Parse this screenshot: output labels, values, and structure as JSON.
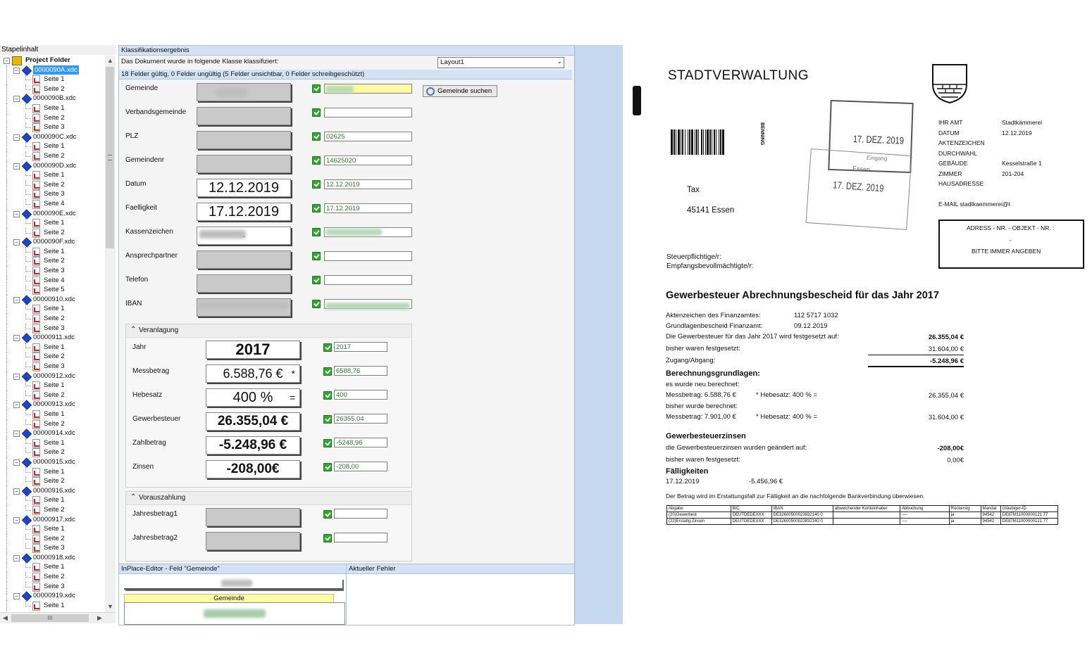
{
  "tree": {
    "title": "Stapelinhalt",
    "root_label": "Project Folder",
    "items": [
      {
        "doc": "0000090A.xdc",
        "pages": [
          "Seite 1",
          "Seite 2"
        ],
        "selected": true
      },
      {
        "doc": "0000090B.xdc",
        "pages": [
          "Seite 1",
          "Seite 2",
          "Seite 3"
        ]
      },
      {
        "doc": "0000090C.xdc",
        "pages": [
          "Seite 1",
          "Seite 2"
        ]
      },
      {
        "doc": "0000090D.xdc",
        "pages": [
          "Seite 1",
          "Seite 2",
          "Seite 3",
          "Seite 4"
        ]
      },
      {
        "doc": "0000090E.xdc",
        "pages": [
          "Seite 1",
          "Seite 2"
        ]
      },
      {
        "doc": "0000090F.xdc",
        "pages": [
          "Seite 1",
          "Seite 2",
          "Seite 3",
          "Seite 4",
          "Seite 5"
        ]
      },
      {
        "doc": "00000910.xdc",
        "pages": [
          "Seite 1",
          "Seite 2",
          "Seite 3"
        ]
      },
      {
        "doc": "00000911.xdc",
        "pages": [
          "Seite 1",
          "Seite 2",
          "Seite 3"
        ]
      },
      {
        "doc": "00000912.xdc",
        "pages": [
          "Seite 1",
          "Seite 2"
        ]
      },
      {
        "doc": "00000913.xdc",
        "pages": [
          "Seite 1",
          "Seite 2"
        ]
      },
      {
        "doc": "00000914.xdc",
        "pages": [
          "Seite 1",
          "Seite 2"
        ]
      },
      {
        "doc": "00000915.xdc",
        "pages": [
          "Seite 1",
          "Seite 2"
        ]
      },
      {
        "doc": "00000916.xdc",
        "pages": [
          "Seite 1",
          "Seite 2"
        ]
      },
      {
        "doc": "00000917.xdc",
        "pages": [
          "Seite 1",
          "Seite 2",
          "Seite 3"
        ]
      },
      {
        "doc": "00000918.xdc",
        "pages": [
          "Seite 1",
          "Seite 2",
          "Seite 3"
        ]
      },
      {
        "doc": "00000919.xdc",
        "pages": [
          "Seite 1"
        ]
      }
    ],
    "hscroll_thumb": "III"
  },
  "classification": {
    "title": "Klassifikationsergebnis",
    "doc_class_label": "Das Dokument wurde in folgende Klasse klassifiziert:",
    "doc_class_value": "Layout1",
    "status": "18 Felder gültig, 0 Felder ungültig (5 Felder unsichtbar, 0 Felder schreibgeschützt)",
    "search_button": "Gemeinde suchen",
    "fields": [
      {
        "label": "Gemeinde",
        "snippet": "",
        "value": ""
      },
      {
        "label": "Verbandsgemeinde",
        "snippet": "",
        "value": ""
      },
      {
        "label": "PLZ",
        "snippet": "",
        "value": "02625"
      },
      {
        "label": "Gemeindenr",
        "snippet": "",
        "value": "14625020"
      },
      {
        "label": "Datum",
        "snippet": "12.12.2019",
        "value": "12.12.2019"
      },
      {
        "label": "Faelligkeit",
        "snippet": "17.12.2019",
        "value": "17.12.2019"
      },
      {
        "label": "Kassenzeichen",
        "snippet": "-",
        "value": ""
      },
      {
        "label": "Ansprechpartner",
        "snippet": "",
        "value": ""
      },
      {
        "label": "Telefon",
        "snippet": "",
        "value": ""
      },
      {
        "label": "IBAN",
        "snippet": "",
        "value": ""
      }
    ],
    "group_veranlagung": {
      "title": "Veranlagung",
      "fields": [
        {
          "label": "Jahr",
          "snippet": "2017",
          "value": "2017"
        },
        {
          "label": "Messbetrag",
          "snippet": "6.588,76 €",
          "snippet_mark": "*",
          "value": "6588,76"
        },
        {
          "label": "Hebesatz",
          "snippet": "400 %",
          "snippet_mark": "=",
          "value": "400"
        },
        {
          "label": "Gewerbesteuer",
          "snippet": "26.355,04 €",
          "value": "26355,04"
        },
        {
          "label": "Zahlbetrag",
          "snippet": "-5.248,96 €",
          "value": "-5248,96"
        },
        {
          "label": "Zinsen",
          "snippet": "-208,00€",
          "value": "-208,00"
        }
      ]
    },
    "group_vorauszahlung": {
      "title": "Vorauszahlung",
      "fields": [
        {
          "label": "Jahresbetrag1",
          "value": ""
        },
        {
          "label": "Jahresbetrag2",
          "value": ""
        }
      ]
    }
  },
  "inplace": {
    "title": "InPlace-Editor - Feld \"Gemeinde\"",
    "field_caption": "Gemeinde"
  },
  "error_panel": {
    "title": "Aktueller Fehler"
  },
  "document": {
    "org": "STADTVERWALTUNG",
    "barcode_side": "BENNING",
    "stamp1_date": "17. DEZ. 2019",
    "stamp1_word": "Eingang",
    "stamp2_city": "Essen",
    "stamp2_date": "17. DEZ. 2019",
    "recipient_line1": "Tax",
    "recipient_line2": "45141 Essen",
    "info_labels": [
      "IHR AMT",
      "DATUM",
      "AKTENZEICHEN",
      "DURCHWAHL",
      "GEBÄUDE",
      "ZIMMER",
      "HAUSADRESSE"
    ],
    "info_values": [
      "Stadtkämmerei",
      "12.12.2019",
      "",
      "",
      "Kesselstraße 1",
      "201-204",
      ""
    ],
    "email": "E-MAIL stadtkaemmerei@t",
    "ref_box_line1": "ADRESS - NR. - OBJEKT - NR. :",
    "ref_box_dash": "-",
    "ref_box_line2": "BITTE IMMER ANGEBEN",
    "taxpayer_line1": "Steuerpflichtige/r:",
    "taxpayer_line2": "Empfangsbevollmächtigte/r:",
    "heading": "Gewerbesteuer Abrechnungsbescheid für das Jahr 2017",
    "az_label": "Aktenzeichen des Finanzamtes:",
    "az_value": "112 5717 1032",
    "grundlagen_label": "Grundlagenbescheid Finanzamt:",
    "grundlagen_value": "09.12.2019",
    "festgesetzt_label": "Die Gewerbesteuer für das Jahr 2017 wird festgesetzt auf:",
    "festgesetzt_value": "26.355,04 €",
    "bisher_label": "bisher waren festgesetzt:",
    "bisher_value": "31.604,00 €",
    "zugang_label": "Zugang/Abgang:",
    "zugang_value": "-5.248,96 €",
    "berechnung_heading": "Berechnungsgrundlagen:",
    "neu_label": "es wurde neu berechnet:",
    "neu_mess": "Messbetrag: 6.588,76 €",
    "neu_hebe": "*  Hebesatz: 400 %  =",
    "neu_value": "26.355,04 €",
    "alt_label": "bisher wurde berechnet:",
    "alt_mess": "Messbetrag: 7.901,00 €",
    "alt_hebe": "*  Hebesatz: 400 %  =",
    "alt_value": "31.604,00 €",
    "zinsen_heading": "Gewerbesteuerzinsen",
    "zinsen_geaendert_label": "die Gewerbesteuerzinsen wurden geändert auf:",
    "zinsen_geaendert_value": "-208,00€",
    "zinsen_bisher_label": "bisher waren festgesetzt:",
    "zinsen_bisher_value": "0,00€",
    "faellig_heading": "Fälligkeiten",
    "faellig_date": "17.12.2019",
    "faellig_value": "-5.456,96 €",
    "bank_note": "Der Betrag wird im Erstattungsfall zur Fälligkeit an die nachfolgende Bankverbindung überwiesen.",
    "table_headers": [
      "Abgabe",
      "BIC",
      "IBAN",
      "abweichender Kontoinhaber",
      "Abbuchung",
      "Rückerstg",
      "Mandat",
      "Gläubiger-ID"
    ],
    "table_rows": [
      [
        "(20)Gewerbest",
        "DEUTDEDEXXX",
        "DE32600500023832140 0",
        "",
        "----",
        "ja",
        "94542",
        "DE87M11000000121 77"
      ],
      [
        "(22)Erstattg Zinsen",
        "DEUTDEDEXXX",
        "DE32600500023832140 0",
        "",
        "----",
        "ja",
        "94542",
        "DE87M11000000121 77"
      ]
    ]
  }
}
